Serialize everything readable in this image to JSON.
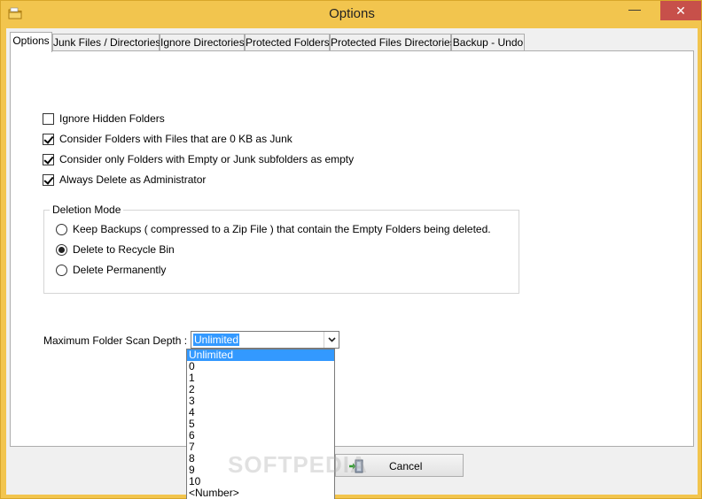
{
  "window": {
    "title": "Options",
    "minimize_glyph": "—",
    "close_glyph": "✕"
  },
  "tabs": [
    {
      "label": "Options",
      "active": true
    },
    {
      "label": "Junk Files / Directories",
      "active": false
    },
    {
      "label": "Ignore Directories",
      "active": false
    },
    {
      "label": "Protected Folders",
      "active": false
    },
    {
      "label": "Protected Files  Directories",
      "active": false
    },
    {
      "label": "Backup - Undo",
      "active": false
    }
  ],
  "options": {
    "checkboxes": [
      {
        "label": "Ignore Hidden Folders",
        "checked": false
      },
      {
        "label": "Consider Folders with Files that are 0 KB as Junk",
        "checked": true
      },
      {
        "label": "Consider only Folders with Empty or Junk subfolders as empty",
        "checked": true
      },
      {
        "label": "Always Delete as Administrator",
        "checked": true
      }
    ],
    "deletion_mode": {
      "legend": "Deletion Mode",
      "radios": [
        {
          "label": "Keep Backups ( compressed to a Zip File ) that contain the Empty Folders being deleted.",
          "selected": false
        },
        {
          "label": "Delete to Recycle Bin",
          "selected": true
        },
        {
          "label": "Delete Permanently",
          "selected": false
        }
      ]
    },
    "scan_depth": {
      "label": "Maximum Folder Scan Depth :",
      "value": "Unlimited",
      "options": [
        "Unlimited",
        "0",
        "1",
        "2",
        "3",
        "4",
        "5",
        "6",
        "7",
        "8",
        "9",
        "10",
        "<Number>"
      ]
    }
  },
  "buttons": {
    "cancel_label": "Cancel"
  },
  "watermark": "SOFTPEDIA",
  "colors": {
    "title_bar": "#f2c54e",
    "close_button": "#c7504a",
    "selection": "#3399ff"
  }
}
